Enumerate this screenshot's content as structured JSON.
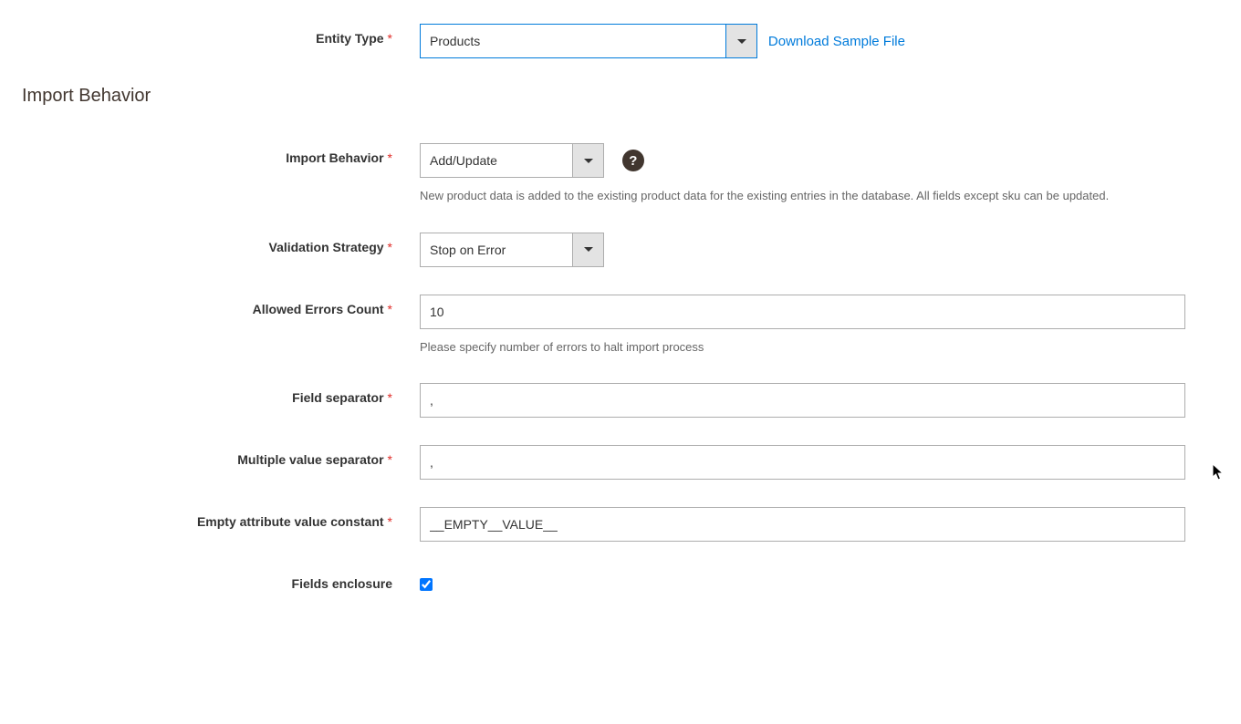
{
  "entityType": {
    "label": "Entity Type",
    "value": "Products",
    "downloadLink": "Download Sample File"
  },
  "sectionTitle": "Import Behavior",
  "importBehavior": {
    "label": "Import Behavior",
    "value": "Add/Update",
    "note": "New product data is added to the existing product data for the existing entries in the database. All fields except sku can be updated."
  },
  "validationStrategy": {
    "label": "Validation Strategy",
    "value": "Stop on Error"
  },
  "allowedErrors": {
    "label": "Allowed Errors Count",
    "value": "10",
    "note": "Please specify number of errors to halt import process"
  },
  "fieldSeparator": {
    "label": "Field separator",
    "value": ","
  },
  "multipleValueSeparator": {
    "label": "Multiple value separator",
    "value": ","
  },
  "emptyAttributeConstant": {
    "label": "Empty attribute value constant",
    "value": "__EMPTY__VALUE__"
  },
  "fieldsEnclosure": {
    "label": "Fields enclosure",
    "checked": true
  },
  "helpGlyph": "?"
}
